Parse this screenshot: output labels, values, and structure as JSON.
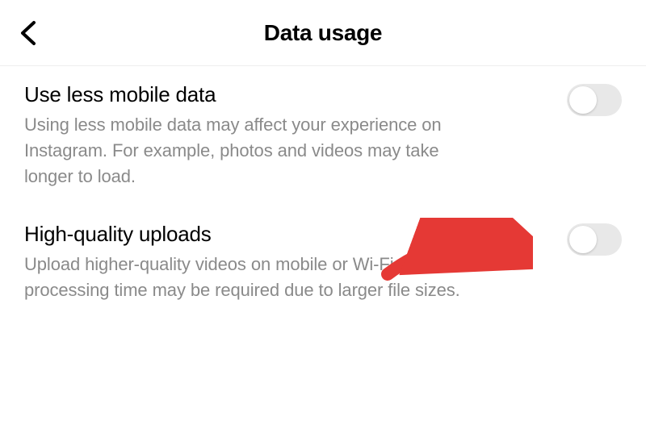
{
  "header": {
    "title": "Data usage"
  },
  "settings": [
    {
      "title": "Use less mobile data",
      "description": "Using less mobile data may affect your experience on Instagram. For example, photos and videos may take longer to load.",
      "enabled": false
    },
    {
      "title": "High-quality uploads",
      "description": "Upload higher-quality videos on mobile or Wi-Fi. Additional processing time may be required due to larger file sizes.",
      "enabled": false
    }
  ]
}
